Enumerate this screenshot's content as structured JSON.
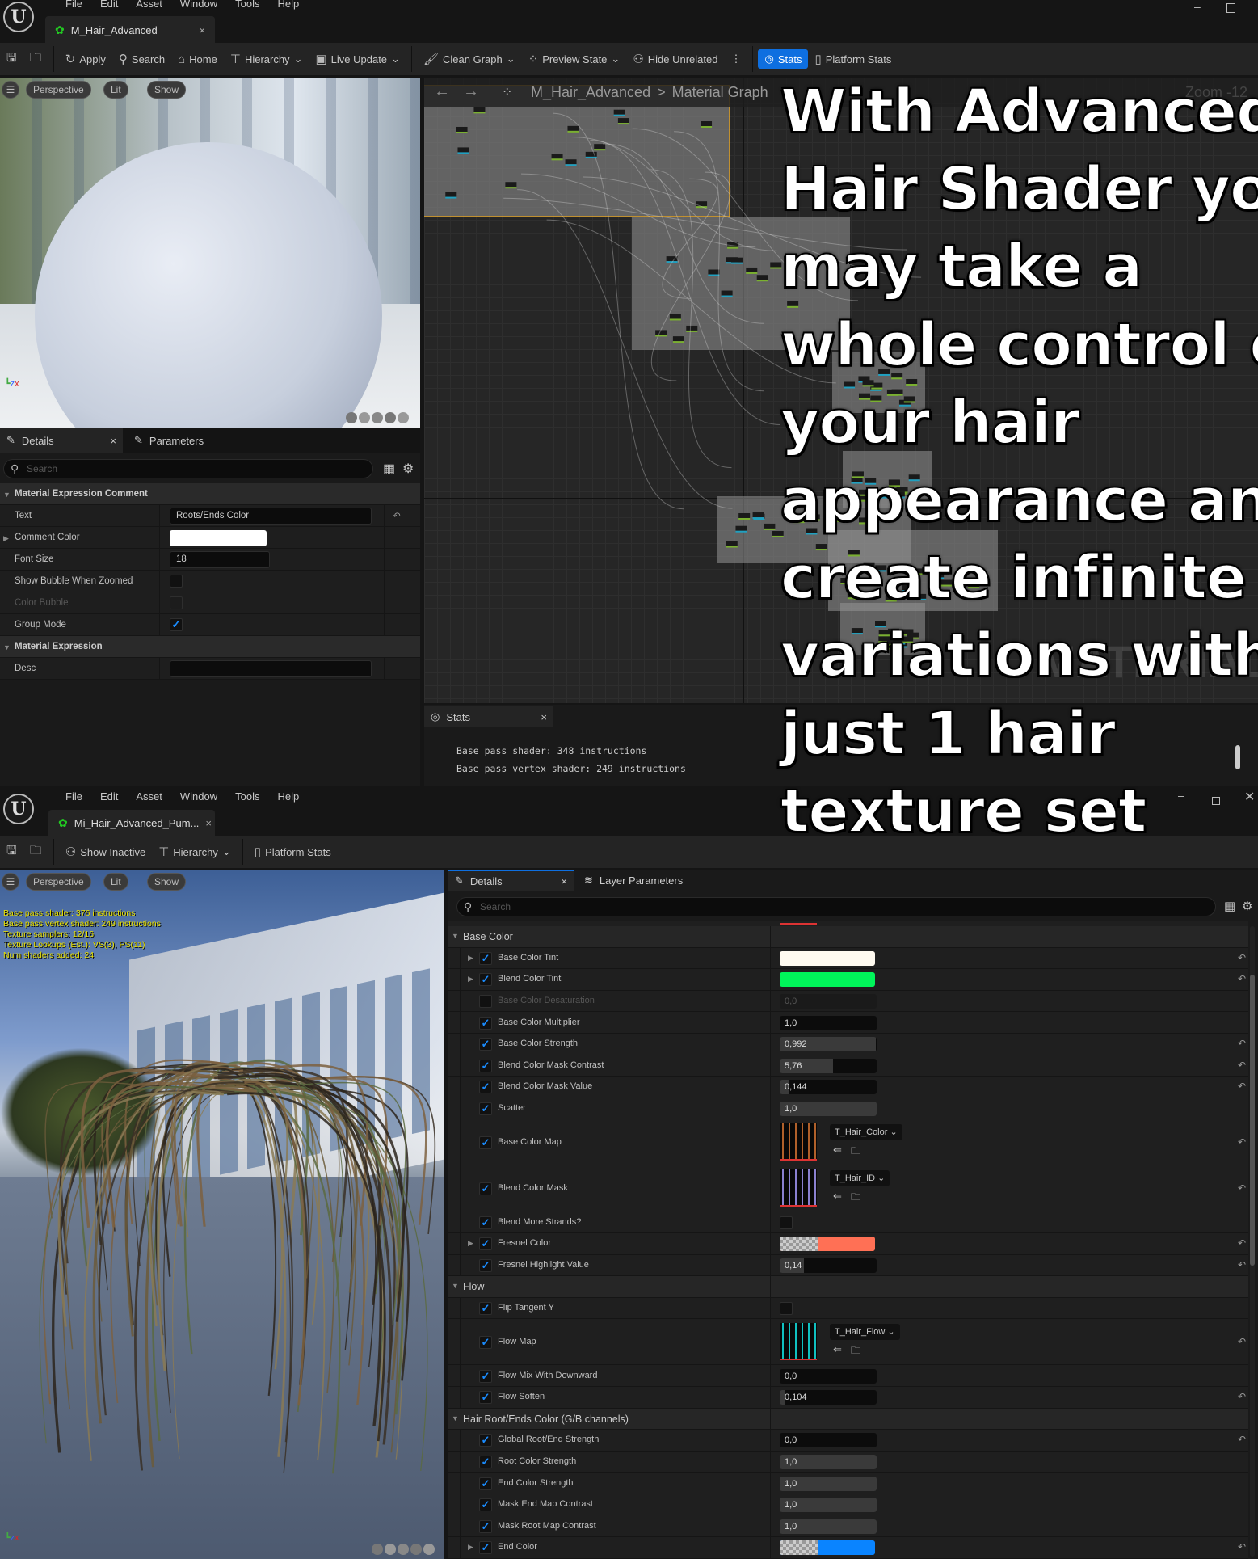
{
  "overlay_text": [
    "With Advanced",
    "Hair Shader you",
    "may take a",
    "whole control of",
    "your hair",
    "appearance and",
    "create infinite",
    "variations with",
    "just 1 hair",
    "texture set"
  ],
  "top_window": {
    "menu": [
      "File",
      "Edit",
      "Asset",
      "Window",
      "Tools",
      "Help"
    ],
    "tab_title": "M_Hair_Advanced",
    "toolbar": {
      "apply": "Apply",
      "search": "Search",
      "home": "Home",
      "hierarchy": "Hierarchy",
      "live_update": "Live Update",
      "clean_graph": "Clean Graph",
      "preview_state": "Preview State",
      "hide_unrelated": "Hide Unrelated",
      "stats": "Stats",
      "platform_stats": "Platform Stats"
    },
    "viewport": {
      "perspective": "Perspective",
      "lit": "Lit",
      "show": "Show"
    },
    "graph": {
      "breadcrumb_asset": "M_Hair_Advanced",
      "breadcrumb_sep": ">",
      "breadcrumb_graph": "Material Graph",
      "zoom": "Zoom -12",
      "watermark": "MATERIAL"
    },
    "details": {
      "tab_details": "Details",
      "tab_parameters": "Parameters",
      "search_placeholder": "Search",
      "section1": "Material Expression Comment",
      "rows": [
        {
          "label": "Text",
          "value": "Roots/Ends Color"
        },
        {
          "label": "Comment Color",
          "color": "#ffffff"
        },
        {
          "label": "Font Size",
          "value": "18"
        },
        {
          "label": "Show Bubble When Zoomed",
          "checked": false
        },
        {
          "label": "Color Bubble",
          "checked": false
        },
        {
          "label": "Group Mode",
          "checked": true
        }
      ],
      "section2": "Material Expression",
      "desc_label": "Desc",
      "desc_value": ""
    },
    "stats": {
      "tab": "Stats",
      "lines": [
        "Base pass shader: 348 instructions",
        "Base pass vertex shader: 249 instructions"
      ]
    }
  },
  "bottom_window": {
    "menu": [
      "File",
      "Edit",
      "Asset",
      "Window",
      "Tools",
      "Help"
    ],
    "tab_title": "Mi_Hair_Advanced_Pum...",
    "toolbar": {
      "show_inactive": "Show Inactive",
      "hierarchy": "Hierarchy",
      "platform_stats": "Platform Stats"
    },
    "viewport": {
      "perspective": "Perspective",
      "lit": "Lit",
      "show": "Show",
      "stats": [
        "Base pass shader: 376 instructions",
        "Base pass vertex shader: 249 instructions",
        "Texture samplers: 12/16",
        "Texture Lookups (Est.): VS(3), PS(11)",
        "Num shaders added: 24"
      ]
    },
    "details": {
      "tab_details": "Details",
      "tab_layer": "Layer Parameters",
      "search_placeholder": "Search",
      "rows": [
        {
          "type": "section",
          "label": "Base Color"
        },
        {
          "type": "color",
          "label": "Base Color Tint",
          "checked": true,
          "color": "#fffaf0",
          "expand": true,
          "reset": true
        },
        {
          "type": "color",
          "label": "Blend Color Tint",
          "checked": true,
          "color": "#00f55a",
          "expand": true,
          "reset": true
        },
        {
          "type": "number",
          "label": "Base Color Desaturation",
          "checked": false,
          "value": "0,0",
          "fill": 0,
          "disabled": true
        },
        {
          "type": "number",
          "label": "Base Color Multiplier",
          "checked": true,
          "value": "1,0",
          "fill": 0
        },
        {
          "type": "number",
          "label": "Base Color Strength",
          "checked": true,
          "value": "0,992",
          "fill": 0.99,
          "reset": true
        },
        {
          "type": "number",
          "label": "Blend Color Mask Contrast",
          "checked": true,
          "value": "5,76",
          "fill": 0.55,
          "reset": true
        },
        {
          "type": "number",
          "label": "Blend Color Mask Value",
          "checked": true,
          "value": "0,144",
          "fill": 0.1,
          "reset": true
        },
        {
          "type": "number",
          "label": "Scatter",
          "checked": true,
          "value": "1,0",
          "fill": 1
        },
        {
          "type": "texture",
          "label": "Base Color Map",
          "checked": true,
          "texture": "T_Hair_Color",
          "tint": "#b0602a",
          "reset": true
        },
        {
          "type": "texture",
          "label": "Blend Color Mask",
          "checked": true,
          "texture": "T_Hair_ID",
          "tint": "#8a80d0",
          "reset": true
        },
        {
          "type": "bool",
          "label": "Blend More Strands?",
          "checked": true,
          "value": false
        },
        {
          "type": "color",
          "label": "Fresnel Color",
          "checked": true,
          "color": "#ff7055",
          "alpha": true,
          "expand": true,
          "reset": true
        },
        {
          "type": "number",
          "label": "Fresnel Highlight Value",
          "checked": true,
          "value": "0,14",
          "fill": 0.25,
          "reset": true
        },
        {
          "type": "section",
          "label": "Flow"
        },
        {
          "type": "bool",
          "label": "Flip Tangent Y",
          "checked": true,
          "value": false
        },
        {
          "type": "texture",
          "label": "Flow Map",
          "checked": true,
          "texture": "T_Hair_Flow",
          "tint": "#10c0c0",
          "reset": true
        },
        {
          "type": "number",
          "label": "Flow Mix With Downward",
          "checked": true,
          "value": "0,0",
          "fill": 0
        },
        {
          "type": "number",
          "label": "Flow Soften",
          "checked": true,
          "value": "0,104",
          "fill": 0.06,
          "reset": true
        },
        {
          "type": "section",
          "label": "Hair Root/Ends Color (G/B channels)"
        },
        {
          "type": "number",
          "label": "Global Root/End Strength",
          "checked": true,
          "value": "0,0",
          "fill": 0,
          "reset": true
        },
        {
          "type": "number",
          "label": "Root Color Strength",
          "checked": true,
          "value": "1,0",
          "fill": 1
        },
        {
          "type": "number",
          "label": "End Color Strength",
          "checked": true,
          "value": "1,0",
          "fill": 1
        },
        {
          "type": "number",
          "label": "Mask End Map Contrast",
          "checked": true,
          "value": "1,0",
          "fill": 1
        },
        {
          "type": "number",
          "label": "Mask Root Map Contrast",
          "checked": true,
          "value": "1,0",
          "fill": 1
        },
        {
          "type": "color",
          "label": "End Color",
          "checked": true,
          "color": "#0a84ff",
          "alpha": true,
          "expand": true,
          "reset": true
        }
      ]
    }
  },
  "colors": {
    "accent": "#0e6fe0",
    "check": "#1a8cff",
    "stats_text": "#e8e000"
  }
}
